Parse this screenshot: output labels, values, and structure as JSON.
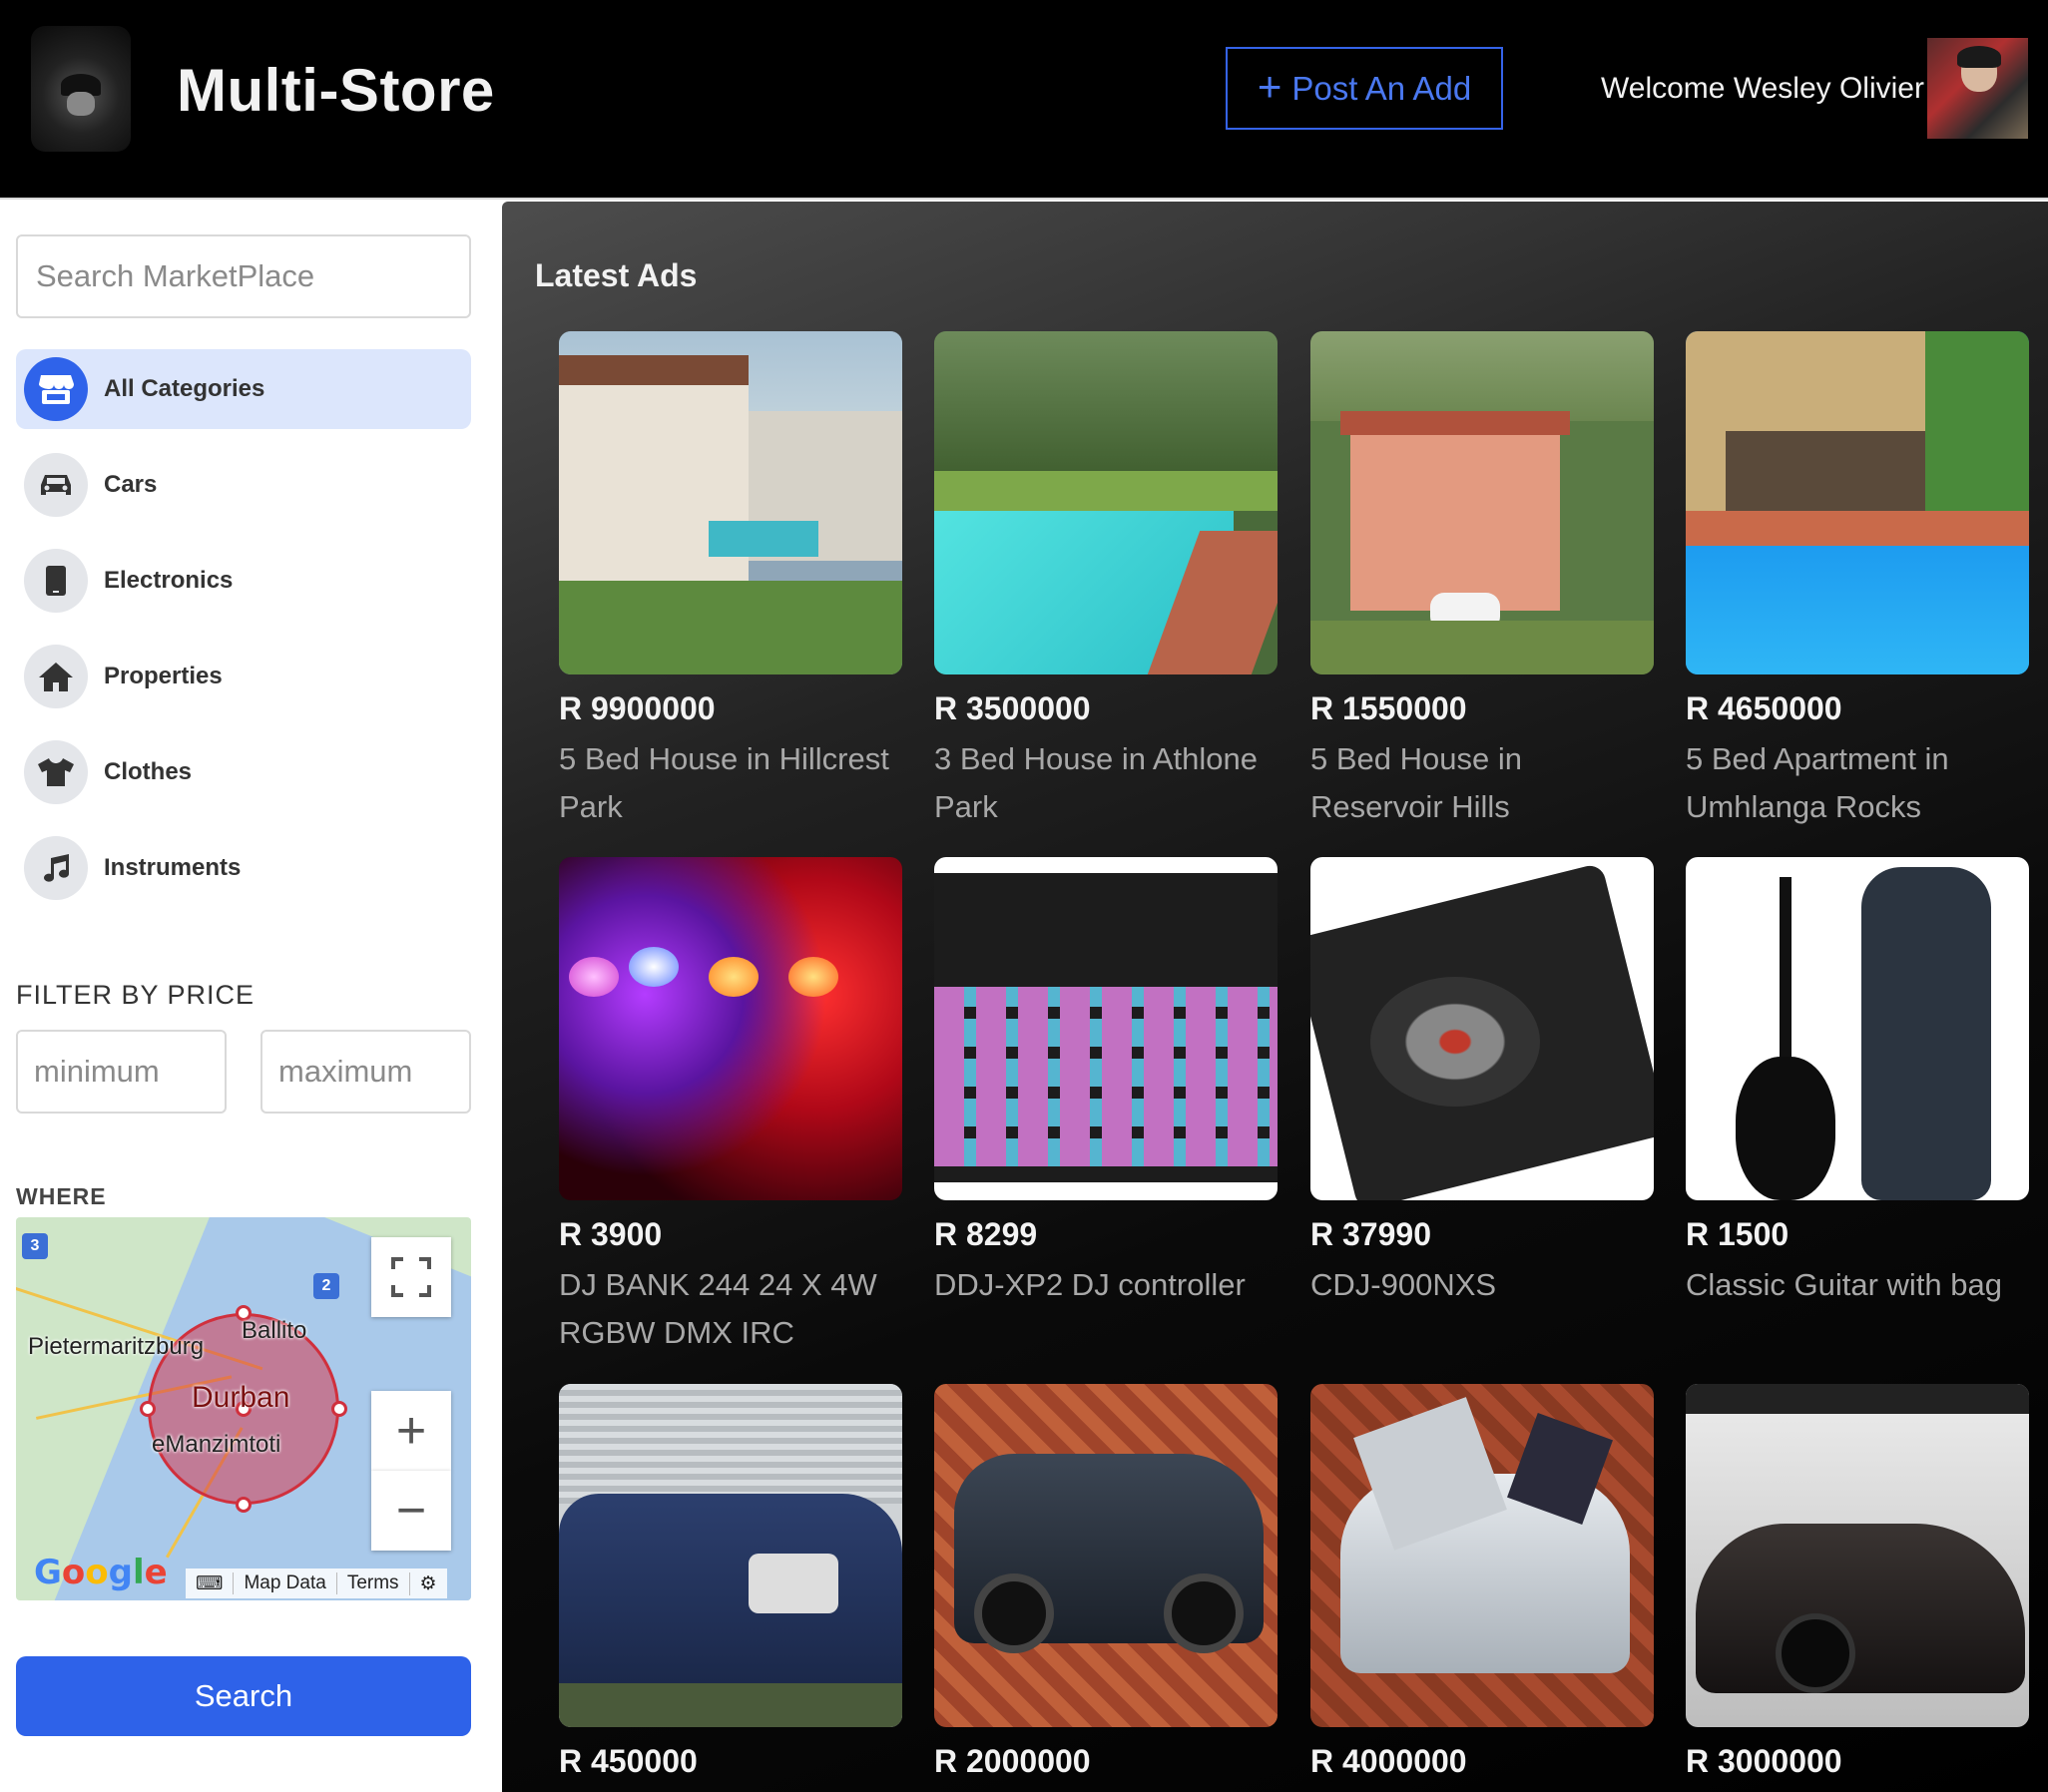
{
  "header": {
    "brand": "Multi-Store",
    "post_button_label": "Post An Add",
    "welcome": "Welcome Wesley Olivier"
  },
  "sidebar": {
    "search_placeholder": "Search MarketPlace",
    "categories": [
      {
        "label": "All Categories",
        "icon": "store-icon",
        "active": true
      },
      {
        "label": "Cars",
        "icon": "car-icon"
      },
      {
        "label": "Electronics",
        "icon": "mobile-icon"
      },
      {
        "label": "Properties",
        "icon": "home-icon"
      },
      {
        "label": "Clothes",
        "icon": "shirt-icon"
      },
      {
        "label": "Instruments",
        "icon": "music-note-icon"
      }
    ],
    "filter_title": "FILTER BY PRICE",
    "min_placeholder": "minimum",
    "max_placeholder": "maximum",
    "where_title": "WHERE",
    "map": {
      "cities": [
        "Pietermaritzburg",
        "Ballito",
        "Durban",
        "eManzimtoti"
      ],
      "route_shields": [
        "3",
        "2"
      ],
      "zoom_in": "+",
      "zoom_out": "−",
      "google": "Google",
      "attribution": [
        "Map Data",
        "Terms"
      ]
    },
    "search_button": "Search"
  },
  "main": {
    "title": "Latest Ads",
    "ads": [
      {
        "price": "R 9900000",
        "title": "5 Bed House in Hillcrest Park"
      },
      {
        "price": "R 3500000",
        "title": "3 Bed House in Athlone Park"
      },
      {
        "price": "R 1550000",
        "title": "5 Bed House in Reservoir Hills"
      },
      {
        "price": "R 4650000",
        "title": "5 Bed Apartment in Umhlanga Rocks"
      },
      {
        "price": "R 3900",
        "title": "DJ BANK 244 24 X 4W RGBW DMX IRC"
      },
      {
        "price": "R 8299",
        "title": "DDJ-XP2 DJ controller"
      },
      {
        "price": "R 37990",
        "title": "CDJ-900NXS"
      },
      {
        "price": "R 1500",
        "title": "Classic Guitar with bag"
      },
      {
        "price": "R 450000",
        "title": ""
      },
      {
        "price": "R 2000000",
        "title": ""
      },
      {
        "price": "R 4000000",
        "title": ""
      },
      {
        "price": "R 3000000",
        "title": ""
      }
    ]
  },
  "colors": {
    "accent": "#2e62e9",
    "header_bg": "#000000",
    "active_category_bg": "#dce6fc"
  }
}
